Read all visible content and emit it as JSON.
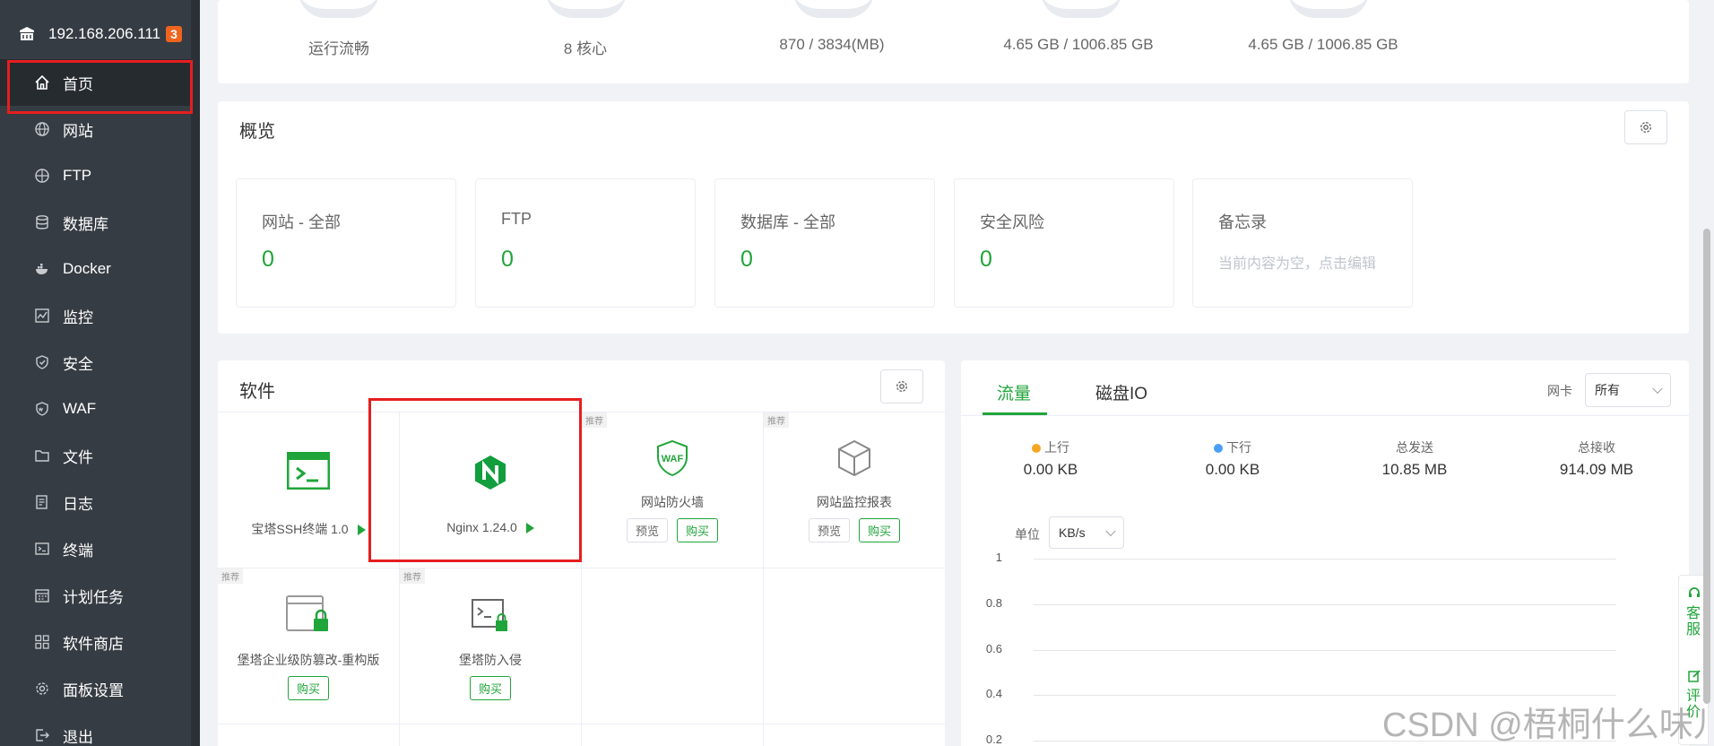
{
  "sidebar": {
    "host": "192.168.206.111",
    "badge": "3",
    "items": [
      {
        "label": "首页",
        "icon": "home-icon"
      },
      {
        "label": "网站",
        "icon": "globe-icon"
      },
      {
        "label": "FTP",
        "icon": "globe-icon"
      },
      {
        "label": "数据库",
        "icon": "database-icon"
      },
      {
        "label": "Docker",
        "icon": "docker-icon"
      },
      {
        "label": "监控",
        "icon": "monitor-icon"
      },
      {
        "label": "安全",
        "icon": "shield-icon"
      },
      {
        "label": "WAF",
        "icon": "waf-shield-icon"
      },
      {
        "label": "文件",
        "icon": "folder-icon"
      },
      {
        "label": "日志",
        "icon": "log-icon"
      },
      {
        "label": "终端",
        "icon": "terminal-icon"
      },
      {
        "label": "计划任务",
        "icon": "calendar-icon"
      },
      {
        "label": "软件商店",
        "icon": "grid-icon"
      },
      {
        "label": "面板设置",
        "icon": "gear-icon"
      },
      {
        "label": "退出",
        "icon": "logout-icon"
      }
    ]
  },
  "stats": [
    "运行流畅",
    "8 核心",
    "870 / 3834(MB)",
    "4.65 GB / 1006.85 GB",
    "4.65 GB / 1006.85 GB"
  ],
  "overview": {
    "title": "概览",
    "boxes": [
      {
        "label": "网站 - 全部",
        "value": "0"
      },
      {
        "label": "FTP",
        "value": "0"
      },
      {
        "label": "数据库 - 全部",
        "value": "0"
      },
      {
        "label": "安全风险",
        "value": "0"
      },
      {
        "label": "备忘录",
        "empty": "当前内容为空，点击编辑"
      }
    ]
  },
  "software": {
    "title": "软件",
    "tag": "推荐",
    "preview_label": "预览",
    "buy_label": "购买",
    "items": [
      {
        "name": "宝塔SSH终端 1.0"
      },
      {
        "name": "Nginx 1.24.0"
      },
      {
        "name": "网站防火墙",
        "icon_text": "WAF"
      },
      {
        "name": "网站监控报表"
      },
      {
        "name": "堡塔企业级防篡改-重构版"
      },
      {
        "name": "堡塔防入侵"
      }
    ]
  },
  "traffic": {
    "tabs": [
      "流量",
      "磁盘IO"
    ],
    "nic_label": "网卡",
    "nic_value": "所有",
    "stats": [
      {
        "label": "上行",
        "value": "0.00 KB",
        "dot": "#f5a623"
      },
      {
        "label": "下行",
        "value": "0.00 KB",
        "dot": "#4a9ff5"
      },
      {
        "label": "总发送",
        "value": "10.85 MB"
      },
      {
        "label": "总接收",
        "value": "914.09 MB"
      }
    ],
    "unit_label": "单位",
    "unit_value": "KB/s",
    "y_ticks": [
      "1",
      "0.8",
      "0.6",
      "0.4",
      "0.2"
    ]
  },
  "right_tools": [
    "客服",
    "评价"
  ],
  "watermark": "CSDN @梧桐什么味儿",
  "colors": {
    "accent": "#20a53a",
    "sidebar": "#363c43",
    "highlight": "#e61e1e",
    "badge": "#f0641e"
  }
}
